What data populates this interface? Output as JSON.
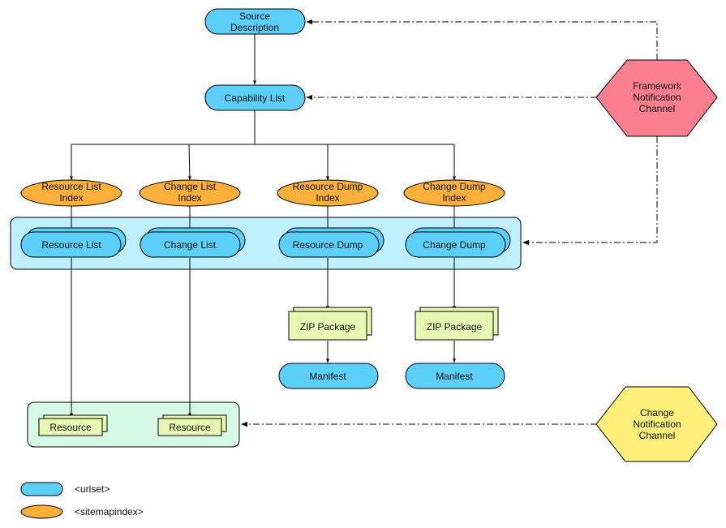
{
  "nodes": {
    "source_description": [
      "Source",
      "Description"
    ],
    "capability_list": [
      "Capability List"
    ],
    "framework_channel": [
      "Framework",
      "Notification",
      "Channel"
    ],
    "change_channel": [
      "Change",
      "Notification",
      "Channel"
    ],
    "resource_list_index": [
      "Resource List",
      "Index"
    ],
    "change_list_index": [
      "Change List",
      "Index"
    ],
    "resource_dump_index": [
      "Resource Dump",
      "Index"
    ],
    "change_dump_index": [
      "Change Dump",
      "Index"
    ],
    "resource_list": "Resource List",
    "change_list": "Change List",
    "resource_dump": "Resource Dump",
    "change_dump": "Change Dump",
    "zip_package_1": "ZIP Package",
    "zip_package_2": "ZIP Package",
    "manifest_1": "Manifest",
    "manifest_2": "Manifest",
    "resource_1": "Resource",
    "resource_2": "Resource"
  },
  "legend": {
    "urlset": "<urlset>",
    "sitemapindex": "<sitemapindex>"
  },
  "colors": {
    "urlset": "#5bcff8",
    "sitemapindex": "#fbb03b",
    "framework_channel": "#fc7f8f",
    "change_channel": "#fef07a",
    "container_blue": "#bff0fd",
    "container_green": "#d5fbe6",
    "package": "#e8f9b4"
  }
}
